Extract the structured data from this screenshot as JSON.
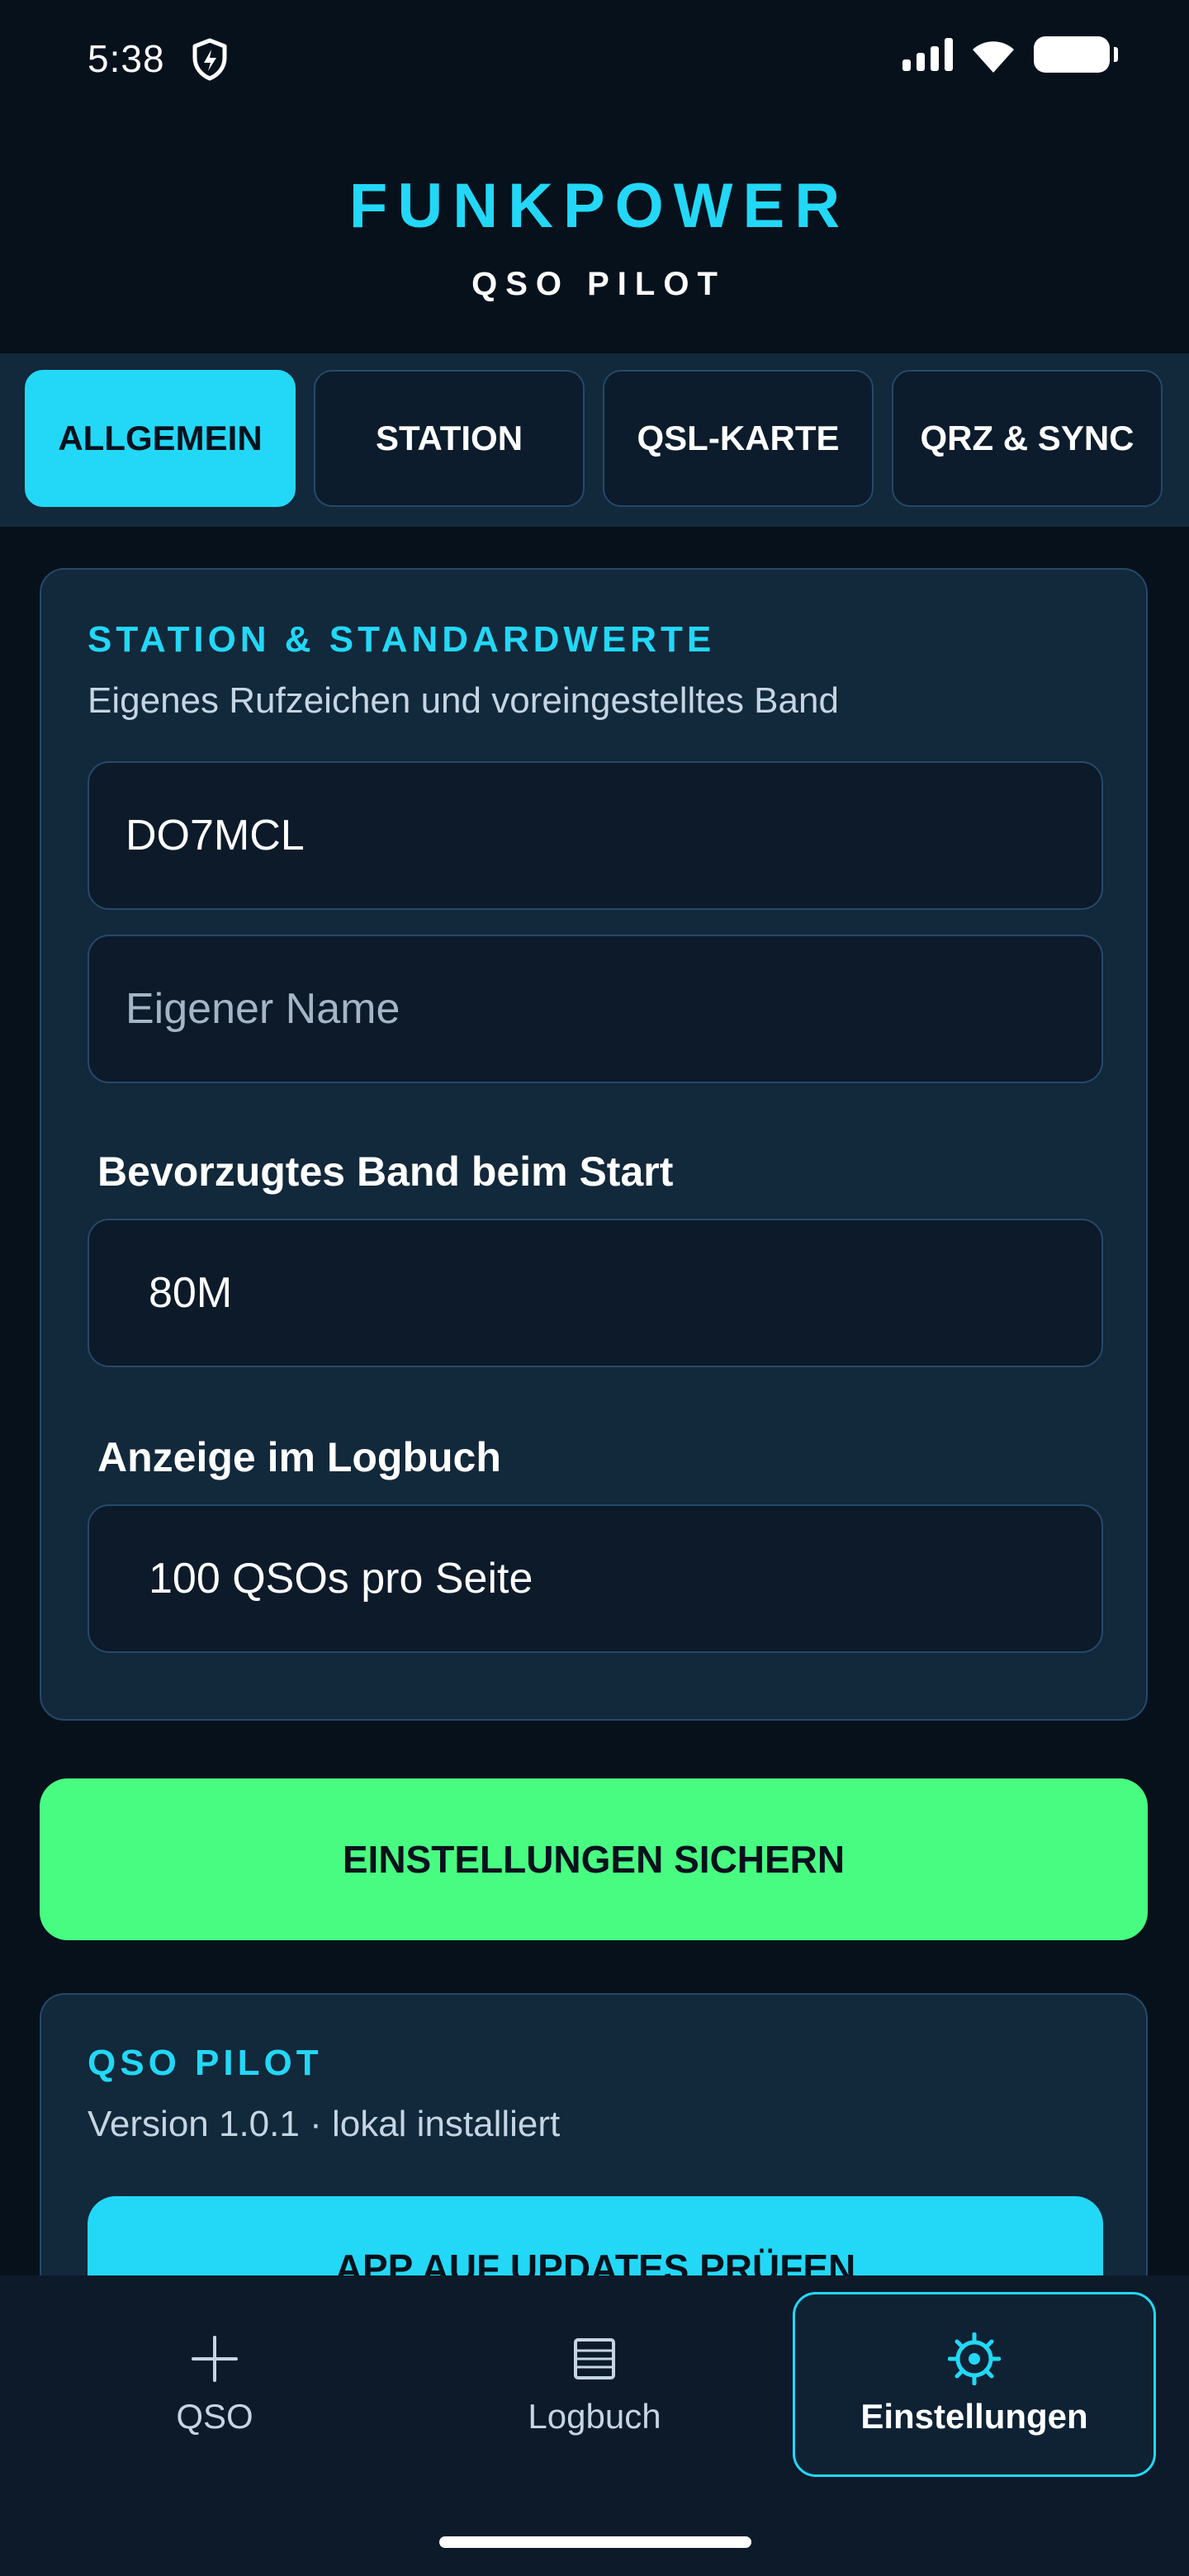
{
  "status_bar": {
    "time": "5:38"
  },
  "header": {
    "title": "FUNKPOWER",
    "subtitle": "QSO PILOT"
  },
  "tabs": [
    {
      "label": "ALLGEMEIN",
      "active": true
    },
    {
      "label": "STATION",
      "active": false
    },
    {
      "label": "QSL-KARTE",
      "active": false
    },
    {
      "label": "QRZ & SYNC",
      "active": false
    }
  ],
  "station_section": {
    "heading": "STATION & STANDARDWERTE",
    "description": "Eigenes Rufzeichen und voreingestelltes Band",
    "callsign_value": "DO7MCL",
    "name_placeholder": "Eigener Name",
    "band_label": "Bevorzugtes Band beim Start",
    "band_value": "80M",
    "logbook_label": "Anzeige im Logbuch",
    "logbook_value": "100 QSOs pro Seite"
  },
  "save_button": {
    "label": "EINSTELLUNGEN SICHERN"
  },
  "app_section": {
    "heading": "QSO PILOT",
    "version_text": "Version 1.0.1 · lokal installiert",
    "update_button_label": "APP AUF UPDATES PRÜFEN"
  },
  "bottom_nav": [
    {
      "label": "QSO",
      "icon": "plus-icon",
      "active": false
    },
    {
      "label": "Logbuch",
      "icon": "list-icon",
      "active": false
    },
    {
      "label": "Einstellungen",
      "icon": "gear-icon",
      "active": true
    }
  ],
  "colors": {
    "accent": "#22d8f6",
    "save_green": "#48fc82",
    "background": "#06111c",
    "card": "#12283b"
  }
}
